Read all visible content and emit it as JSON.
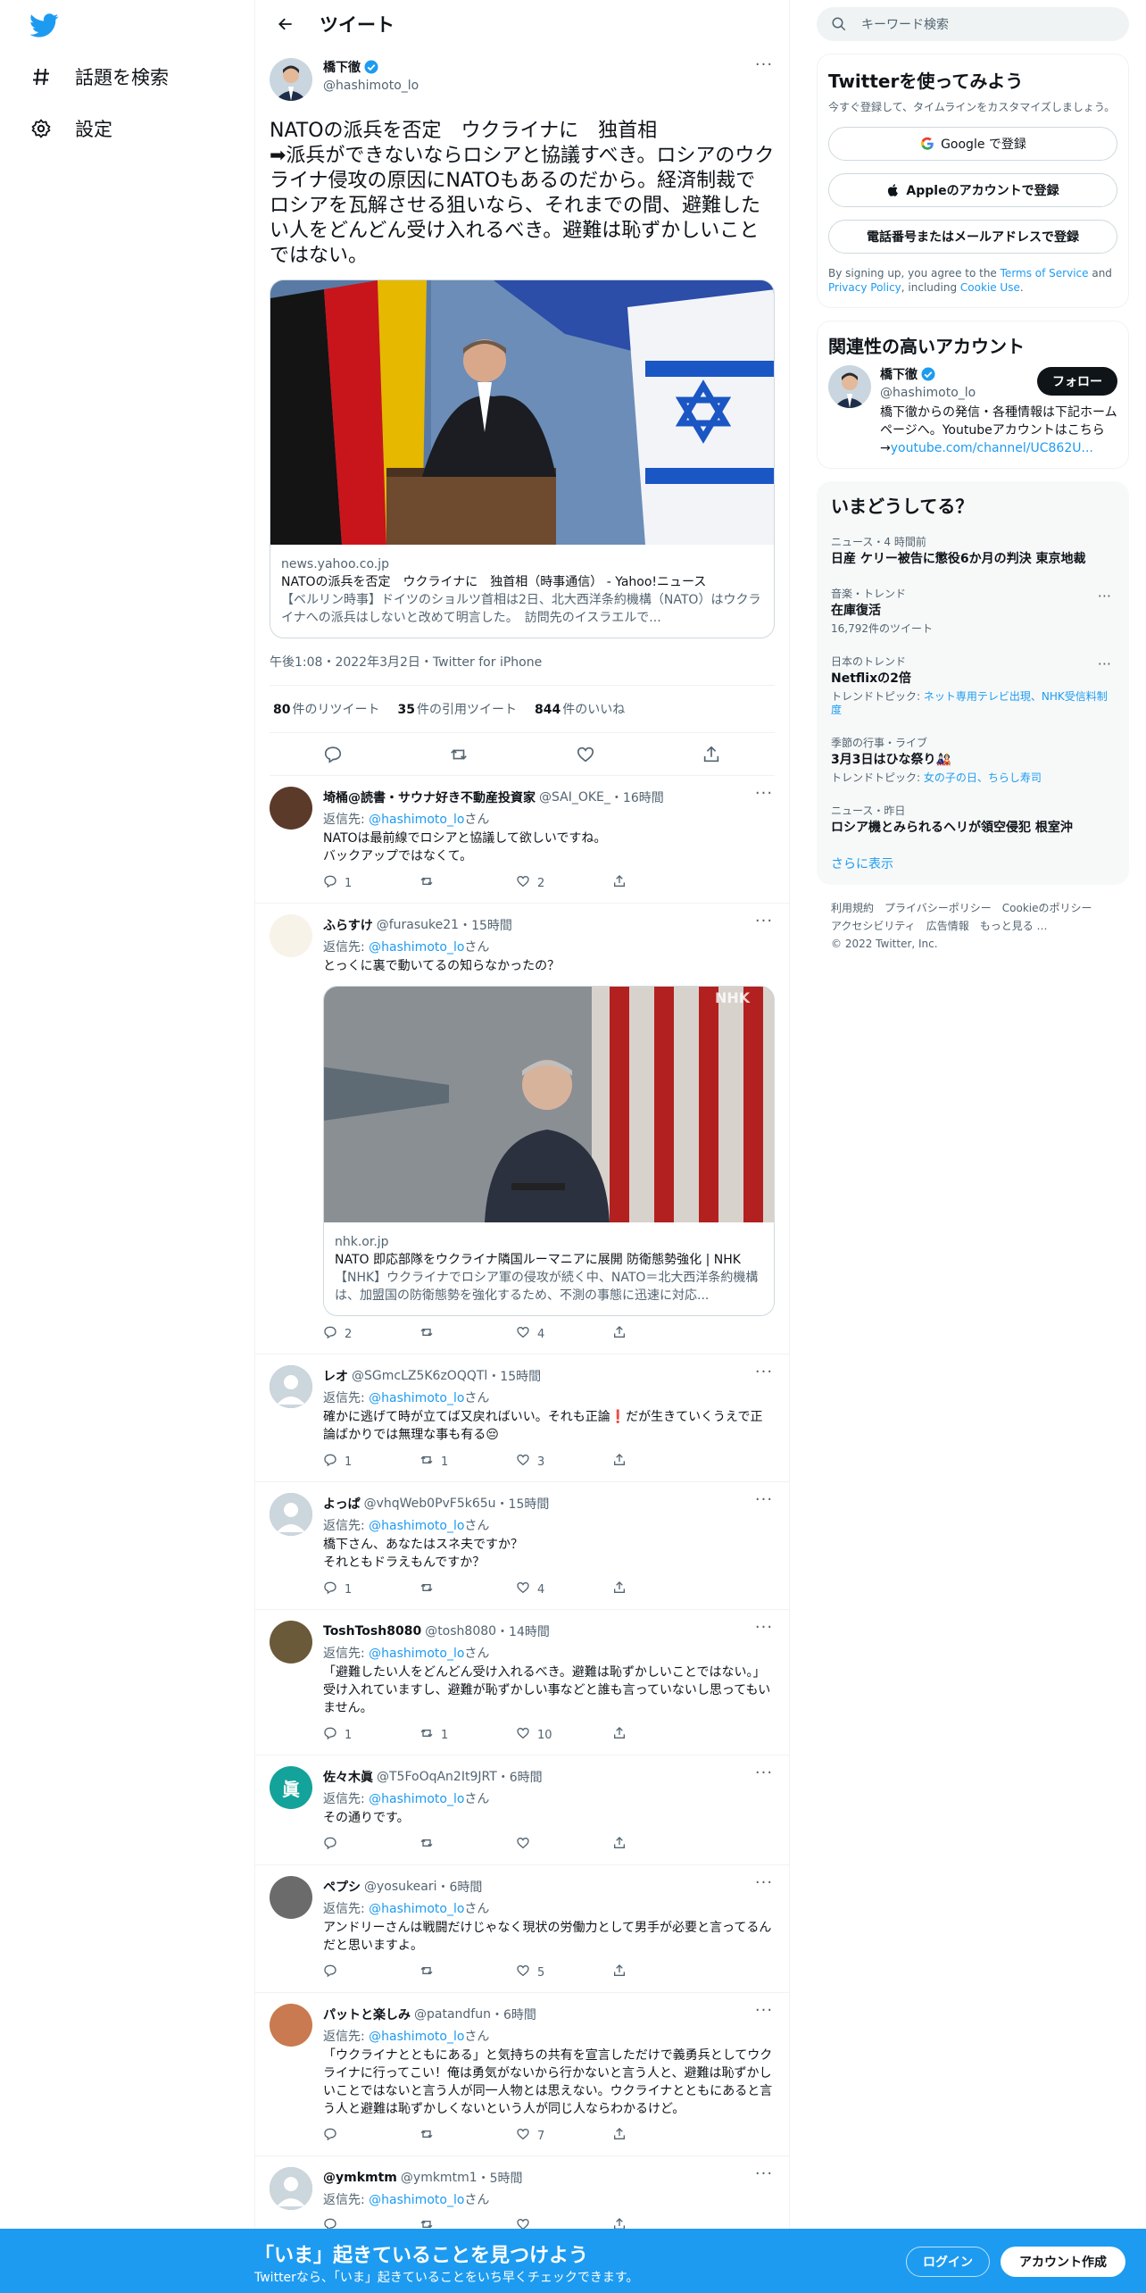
{
  "nav": {
    "explore_label": "話題を検索",
    "settings_label": "設定"
  },
  "header": {
    "title": "ツイート"
  },
  "focal": {
    "name": "橋下徹",
    "handle": "@hashimoto_lo",
    "text": "NATOの派兵を否定　ウクライナに　独首相\n➡派兵ができないならロシアと協議すべき。ロシアのウクライナ侵攻の原因にNATOもあるのだから。経済制裁でロシアを瓦解させる狙いなら、それまでの間、避難したい人をどんどん受け入れるべき。避難は恥ずかしいことではない。",
    "card": {
      "domain": "news.yahoo.co.jp",
      "title": "NATOの派兵を否定　ウクライナに　独首相（時事通信） - Yahoo!ニュース",
      "desc": "【ベルリン時事】ドイツのショルツ首相は2日、北大西洋条約機構（NATO）はウクライナへの派兵はしないと改めて明言した。　訪問先のイスラエルで..."
    },
    "meta": "午後1:08・2022年3月2日・Twitter for iPhone",
    "retweets": "80",
    "retweets_label": "件のリツイート",
    "quotes": "35",
    "quotes_label": "件の引用ツイート",
    "likes": "844",
    "likes_label": "件のいいね"
  },
  "replies": [
    {
      "name": "埼桶@読書・サウナ好き不動産投資家",
      "handle": "@SAI_OKE_",
      "time": "・16時間",
      "replyto_prefix": "返信先: ",
      "replyto": "@hashimoto_lo",
      "replyto_suffix": "さん",
      "text": "NATOは最前線でロシアと協議して欲しいですね。\nバックアップではなくて。",
      "reply_count": "1",
      "retweet_count": "",
      "like_count": "2"
    },
    {
      "name": "ふらすけ",
      "handle": "@furasuke21",
      "time": "・15時間",
      "replyto_prefix": "返信先: ",
      "replyto": "@hashimoto_lo",
      "replyto_suffix": "さん",
      "text": "とっくに裏で動いてるの知らなかったの？",
      "card": {
        "domain": "nhk.or.jp",
        "title": "NATO 即応部隊をウクライナ隣国ルーマニアに展開 防衛態勢強化 | NHK",
        "desc": "【NHK】ウクライナでロシア軍の侵攻が続く中、NATO＝北大西洋条約機構は、加盟国の防衛態勢を強化するため、不測の事態に迅速に対応..."
      },
      "reply_count": "2",
      "retweet_count": "",
      "like_count": "4"
    },
    {
      "name": "レオ",
      "handle": "@SGmcLZ5K6zOQQTl",
      "time": "・15時間",
      "replyto_prefix": "返信先: ",
      "replyto": "@hashimoto_lo",
      "replyto_suffix": "さん",
      "text": "確かに逃げて時が立てば又戻ればいい。それも正論❗だが生きていくうえで正論ばかりでは無理な事も有る😔",
      "reply_count": "1",
      "retweet_count": "1",
      "like_count": "3"
    },
    {
      "name": "よっぱ",
      "handle": "@vhqWeb0PvF5k65u",
      "time": "・15時間",
      "replyto_prefix": "返信先: ",
      "replyto": "@hashimoto_lo",
      "replyto_suffix": "さん",
      "text": "橋下さん、あなたはスネ夫ですか？\nそれともドラえもんですか？",
      "reply_count": "1",
      "retweet_count": "",
      "like_count": "4"
    },
    {
      "name": "ToshTosh8080",
      "handle": "@tosh8080",
      "time": "・14時間",
      "replyto_prefix": "返信先: ",
      "replyto": "@hashimoto_lo",
      "replyto_suffix": "さん",
      "text": "「避難したい人をどんどん受け入れるべき。避難は恥ずかしいことではない。」\n受け入れていますし、避難が恥ずかしい事などと誰も言っていないし思ってもいません。",
      "reply_count": "1",
      "retweet_count": "1",
      "like_count": "10"
    },
    {
      "name": "佐々木眞",
      "handle": "@T5FoOqAn2It9JRT",
      "time": "・6時間",
      "replyto_prefix": "返信先: ",
      "replyto": "@hashimoto_lo",
      "replyto_suffix": "さん",
      "text": "その通りです。",
      "reply_count": "",
      "retweet_count": "",
      "like_count": ""
    },
    {
      "name": "ペプシ",
      "handle": "@yosukeari",
      "time": "・6時間",
      "replyto_prefix": "返信先: ",
      "replyto": "@hashimoto_lo",
      "replyto_suffix": "さん",
      "text": "アンドリーさんは戦闘だけじゃなく現状の労働力として男手が必要と言ってるんだと思いますよ。",
      "reply_count": "",
      "retweet_count": "",
      "like_count": "5"
    },
    {
      "name": "パットと楽しみ",
      "handle": "@patandfun",
      "time": "・6時間",
      "replyto_prefix": "返信先: ",
      "replyto": "@hashimoto_lo",
      "replyto_suffix": "さん",
      "text": "「ウクライナとともにある」と気持ちの共有を宣言しただけで義勇兵としてウクライナに行ってこい！俺は勇気がないから行かないと言う人と、避難は恥ずかしいことではないと言う人が同一人物とは思えない。ウクライナとともにあると言う人と避難は恥ずかしくないという人が同じ人ならわかるけど。",
      "reply_count": "",
      "retweet_count": "",
      "like_count": "7"
    },
    {
      "name": "@ymkmtm",
      "handle": "@ymkmtm1",
      "time": "・5時間",
      "replyto_prefix": "返信先: ",
      "replyto": "@hashimoto_lo",
      "replyto_suffix": "さん",
      "text": "",
      "reply_count": "",
      "retweet_count": "",
      "like_count": ""
    }
  ],
  "sidebar": {
    "search_placeholder": "キーワード検索",
    "signup": {
      "title": "Twitterを使ってみよう",
      "sub": "今すぐ登録して、タイムラインをカスタマイズしましょう。",
      "google": "Google で登録",
      "apple": "Appleのアカウントで登録",
      "phone": "電話番号またはメールアドレスで登録",
      "legal_1": "By signing up, you agree to the ",
      "tos": "Terms of Service",
      "legal_2": " and ",
      "privacy": "Privacy Policy",
      "legal_3": ", including ",
      "cookie": "Cookie Use",
      "legal_4": "."
    },
    "related": {
      "title": "関連性の高いアカウント",
      "name": "橋下徹",
      "handle": "@hashimoto_lo",
      "follow": "フォロー",
      "bio": "橋下徹からの発信・各種情報は下記ホームページへ。Youtubeアカウントはこちら\n→",
      "bio_link": "youtube.com/channel/UC862U..."
    },
    "trends": {
      "title": "いまどうしてる？",
      "items": [
        {
          "top": "ニュース・4 時間前",
          "name": "日産 ケリー被告に懲役6か月の判決 東京地裁",
          "sub": ""
        },
        {
          "top": "音楽・トレンド",
          "name": "在庫復活",
          "sub": "16,792件のツイート"
        },
        {
          "top": "日本のトレンド",
          "name": "Netflixの2倍",
          "sub_prefix": "トレンドトピック: ",
          "sub_link": "ネット専用テレビ出現、NHK受信料制度"
        },
        {
          "top": "季節の行事・ライブ",
          "name": "3月3日はひな祭り🎎",
          "sub_prefix": "トレンドトピック: ",
          "sub_link": "女の子の日、ちらし寿司"
        },
        {
          "top": "ニュース・昨日",
          "name": "ロシア機とみられるヘリが領空侵犯 根室沖",
          "sub": ""
        }
      ],
      "more": "さらに表示"
    },
    "footer": [
      "利用規約",
      "プライバシーポリシー",
      "Cookieのポリシー",
      "アクセシビリティ",
      "広告情報",
      "もっと見る …",
      "© 2022 Twitter, Inc."
    ]
  },
  "bottom": {
    "title": "「いま」起きていることを見つけよう",
    "sub": "Twitterなら、「いま」起きていることをいち早くチェックできます。",
    "login": "ログイン",
    "signup": "アカウント作成"
  },
  "colors": {
    "accent": "#1d9bf0",
    "text": "#0f1419",
    "muted": "#536471"
  }
}
